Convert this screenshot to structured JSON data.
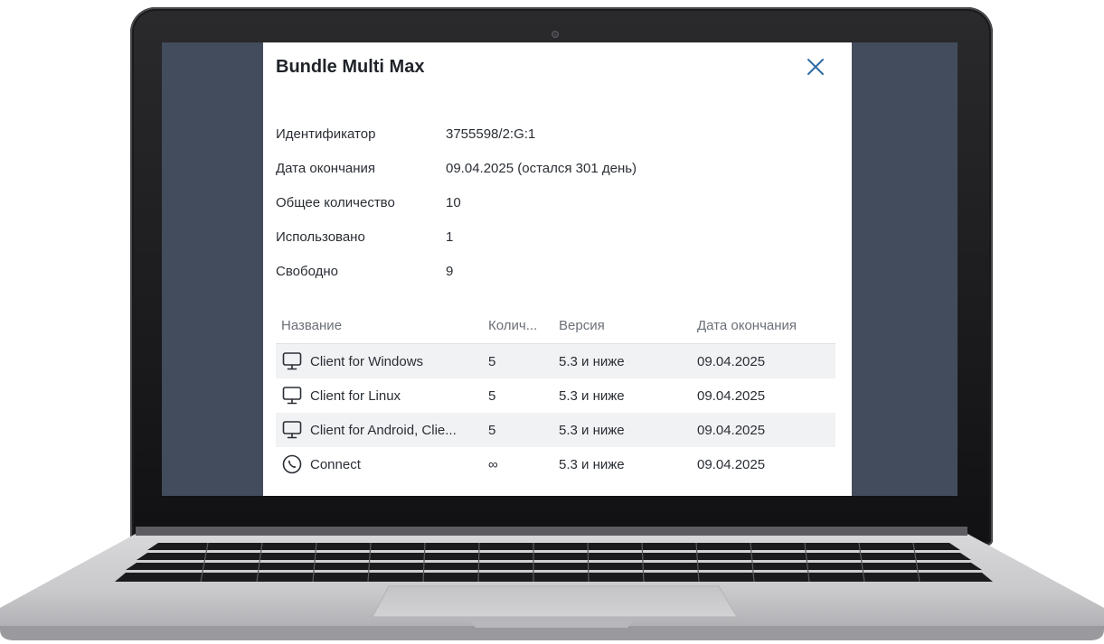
{
  "dialog": {
    "title": "Bundle Multi Max",
    "info": [
      {
        "label": "Идентификатор",
        "value": "3755598/2:G:1"
      },
      {
        "label": "Дата окончания",
        "value": "09.04.2025 (остался 301 день)"
      },
      {
        "label": "Общее количество",
        "value": "10"
      },
      {
        "label": "Использовано",
        "value": "1"
      },
      {
        "label": "Свободно",
        "value": "9"
      }
    ],
    "table": {
      "headers": [
        "Название",
        "Колич...",
        "Версия",
        "Дата окончания"
      ],
      "rows": [
        {
          "icon": "monitor-icon",
          "name": "Client for Windows",
          "count": "5",
          "version": "5.3 и ниже",
          "date": "09.04.2025"
        },
        {
          "icon": "monitor-icon",
          "name": "Client for Linux",
          "count": "5",
          "version": "5.3 и ниже",
          "date": "09.04.2025"
        },
        {
          "icon": "monitor-icon",
          "name": "Client for Android, Clie...",
          "count": "5",
          "version": "5.3 и ниже",
          "date": "09.04.2025"
        },
        {
          "icon": "phone-circle-icon",
          "name": "Connect",
          "count": "∞",
          "version": "5.3 и ниже",
          "date": "09.04.2025"
        }
      ]
    }
  },
  "colors": {
    "screen_background": "#424c5c",
    "accent": "#2e6da4"
  }
}
